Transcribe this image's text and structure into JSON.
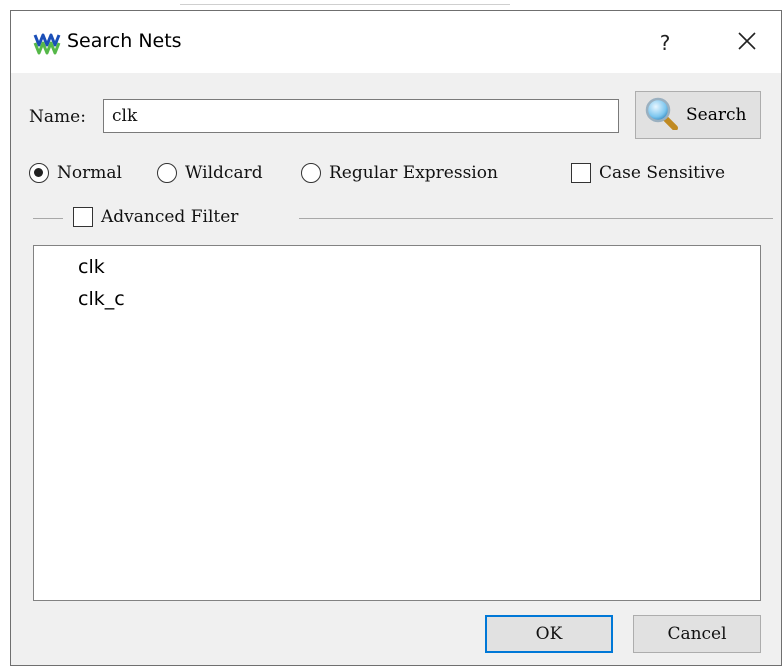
{
  "window": {
    "title": "Search Nets",
    "help_label": "?"
  },
  "search": {
    "name_label": "Name:",
    "value": "clk",
    "button_label": "Search"
  },
  "mode": {
    "options": [
      {
        "label": "Normal",
        "selected": true
      },
      {
        "label": "Wildcard",
        "selected": false
      },
      {
        "label": "Regular Expression",
        "selected": false
      }
    ],
    "case_sensitive_label": "Case Sensitive",
    "case_sensitive_checked": false
  },
  "advanced_filter": {
    "label": "Advanced Filter",
    "checked": false
  },
  "results": [
    "clk",
    "clk_c"
  ],
  "footer": {
    "ok_label": "OK",
    "cancel_label": "Cancel"
  },
  "colors": {
    "dialog_bg": "#f0f0f0",
    "accent": "#0078d7",
    "logo_blue": "#1b4fb8",
    "logo_green": "#55b848"
  }
}
